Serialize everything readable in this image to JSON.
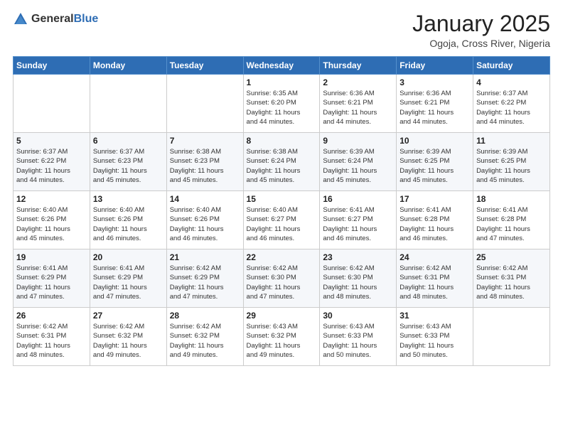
{
  "logo": {
    "general": "General",
    "blue": "Blue"
  },
  "title": "January 2025",
  "subtitle": "Ogoja, Cross River, Nigeria",
  "days_header": [
    "Sunday",
    "Monday",
    "Tuesday",
    "Wednesday",
    "Thursday",
    "Friday",
    "Saturday"
  ],
  "weeks": [
    [
      {
        "day": "",
        "info": ""
      },
      {
        "day": "",
        "info": ""
      },
      {
        "day": "",
        "info": ""
      },
      {
        "day": "1",
        "info": "Sunrise: 6:35 AM\nSunset: 6:20 PM\nDaylight: 11 hours\nand 44 minutes."
      },
      {
        "day": "2",
        "info": "Sunrise: 6:36 AM\nSunset: 6:21 PM\nDaylight: 11 hours\nand 44 minutes."
      },
      {
        "day": "3",
        "info": "Sunrise: 6:36 AM\nSunset: 6:21 PM\nDaylight: 11 hours\nand 44 minutes."
      },
      {
        "day": "4",
        "info": "Sunrise: 6:37 AM\nSunset: 6:22 PM\nDaylight: 11 hours\nand 44 minutes."
      }
    ],
    [
      {
        "day": "5",
        "info": "Sunrise: 6:37 AM\nSunset: 6:22 PM\nDaylight: 11 hours\nand 44 minutes."
      },
      {
        "day": "6",
        "info": "Sunrise: 6:37 AM\nSunset: 6:23 PM\nDaylight: 11 hours\nand 45 minutes."
      },
      {
        "day": "7",
        "info": "Sunrise: 6:38 AM\nSunset: 6:23 PM\nDaylight: 11 hours\nand 45 minutes."
      },
      {
        "day": "8",
        "info": "Sunrise: 6:38 AM\nSunset: 6:24 PM\nDaylight: 11 hours\nand 45 minutes."
      },
      {
        "day": "9",
        "info": "Sunrise: 6:39 AM\nSunset: 6:24 PM\nDaylight: 11 hours\nand 45 minutes."
      },
      {
        "day": "10",
        "info": "Sunrise: 6:39 AM\nSunset: 6:25 PM\nDaylight: 11 hours\nand 45 minutes."
      },
      {
        "day": "11",
        "info": "Sunrise: 6:39 AM\nSunset: 6:25 PM\nDaylight: 11 hours\nand 45 minutes."
      }
    ],
    [
      {
        "day": "12",
        "info": "Sunrise: 6:40 AM\nSunset: 6:26 PM\nDaylight: 11 hours\nand 45 minutes."
      },
      {
        "day": "13",
        "info": "Sunrise: 6:40 AM\nSunset: 6:26 PM\nDaylight: 11 hours\nand 46 minutes."
      },
      {
        "day": "14",
        "info": "Sunrise: 6:40 AM\nSunset: 6:26 PM\nDaylight: 11 hours\nand 46 minutes."
      },
      {
        "day": "15",
        "info": "Sunrise: 6:40 AM\nSunset: 6:27 PM\nDaylight: 11 hours\nand 46 minutes."
      },
      {
        "day": "16",
        "info": "Sunrise: 6:41 AM\nSunset: 6:27 PM\nDaylight: 11 hours\nand 46 minutes."
      },
      {
        "day": "17",
        "info": "Sunrise: 6:41 AM\nSunset: 6:28 PM\nDaylight: 11 hours\nand 46 minutes."
      },
      {
        "day": "18",
        "info": "Sunrise: 6:41 AM\nSunset: 6:28 PM\nDaylight: 11 hours\nand 47 minutes."
      }
    ],
    [
      {
        "day": "19",
        "info": "Sunrise: 6:41 AM\nSunset: 6:29 PM\nDaylight: 11 hours\nand 47 minutes."
      },
      {
        "day": "20",
        "info": "Sunrise: 6:41 AM\nSunset: 6:29 PM\nDaylight: 11 hours\nand 47 minutes."
      },
      {
        "day": "21",
        "info": "Sunrise: 6:42 AM\nSunset: 6:29 PM\nDaylight: 11 hours\nand 47 minutes."
      },
      {
        "day": "22",
        "info": "Sunrise: 6:42 AM\nSunset: 6:30 PM\nDaylight: 11 hours\nand 47 minutes."
      },
      {
        "day": "23",
        "info": "Sunrise: 6:42 AM\nSunset: 6:30 PM\nDaylight: 11 hours\nand 48 minutes."
      },
      {
        "day": "24",
        "info": "Sunrise: 6:42 AM\nSunset: 6:31 PM\nDaylight: 11 hours\nand 48 minutes."
      },
      {
        "day": "25",
        "info": "Sunrise: 6:42 AM\nSunset: 6:31 PM\nDaylight: 11 hours\nand 48 minutes."
      }
    ],
    [
      {
        "day": "26",
        "info": "Sunrise: 6:42 AM\nSunset: 6:31 PM\nDaylight: 11 hours\nand 48 minutes."
      },
      {
        "day": "27",
        "info": "Sunrise: 6:42 AM\nSunset: 6:32 PM\nDaylight: 11 hours\nand 49 minutes."
      },
      {
        "day": "28",
        "info": "Sunrise: 6:42 AM\nSunset: 6:32 PM\nDaylight: 11 hours\nand 49 minutes."
      },
      {
        "day": "29",
        "info": "Sunrise: 6:43 AM\nSunset: 6:32 PM\nDaylight: 11 hours\nand 49 minutes."
      },
      {
        "day": "30",
        "info": "Sunrise: 6:43 AM\nSunset: 6:33 PM\nDaylight: 11 hours\nand 50 minutes."
      },
      {
        "day": "31",
        "info": "Sunrise: 6:43 AM\nSunset: 6:33 PM\nDaylight: 11 hours\nand 50 minutes."
      },
      {
        "day": "",
        "info": ""
      }
    ]
  ]
}
